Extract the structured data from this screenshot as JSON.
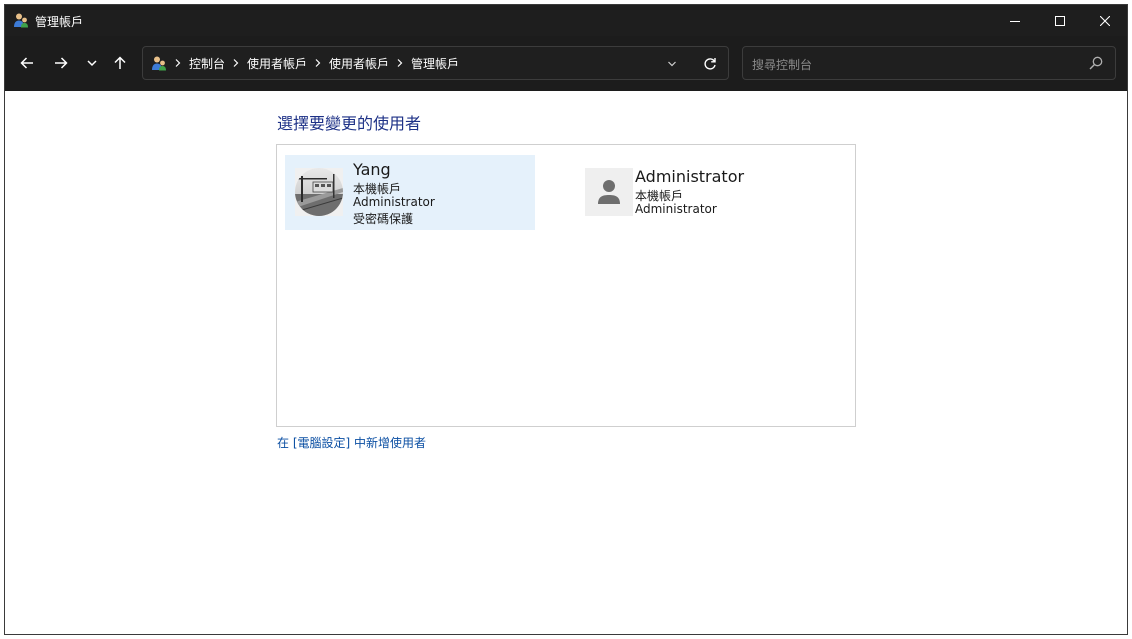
{
  "window": {
    "title": "管理帳戶"
  },
  "navigation": {
    "breadcrumbs": [
      "控制台",
      "使用者帳戶",
      "使用者帳戶",
      "管理帳戶"
    ],
    "search_placeholder": "搜尋控制台"
  },
  "main": {
    "heading": "選擇要變更的使用者",
    "users": [
      {
        "name": "Yang",
        "type": "本機帳戶",
        "role": "Administrator",
        "protection": "受密碼保護",
        "avatar": "photo-avatar",
        "selected": true
      },
      {
        "name": "Administrator",
        "type": "本機帳戶",
        "role": "Administrator",
        "avatar": "default-user-avatar",
        "selected": false
      }
    ],
    "add_user_link": "在 [電腦設定] 中新增使用者"
  },
  "colors": {
    "titlebar": "#1e1e1e",
    "navbar": "#1c1c1c",
    "heading_text": "#1e3287",
    "link_text": "#0b4fa3",
    "selected_tile": "#e5f1fb"
  }
}
